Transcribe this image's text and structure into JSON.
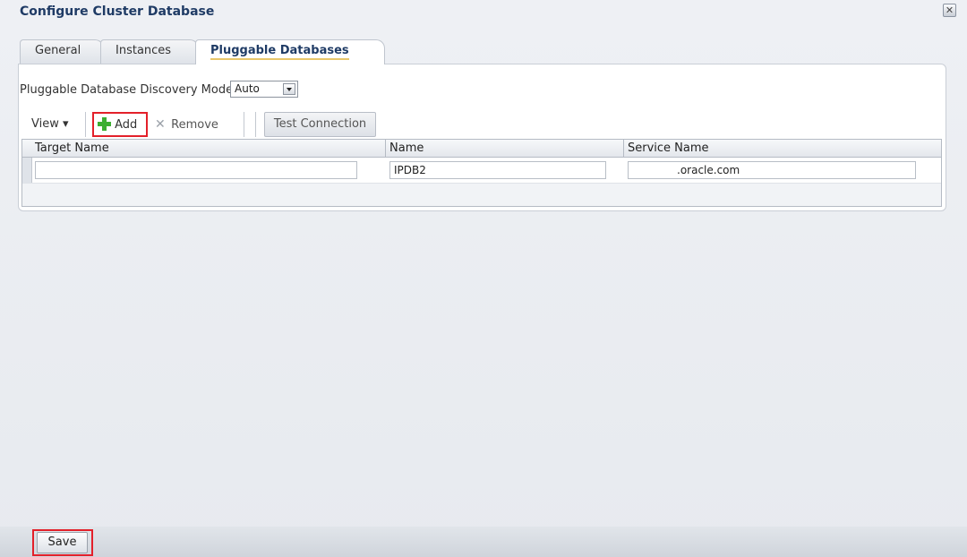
{
  "dialog": {
    "title": "Configure Cluster Database",
    "close_glyph": "✕"
  },
  "tabs": [
    {
      "label": "General"
    },
    {
      "label": "Instances"
    },
    {
      "label": "Pluggable Databases",
      "active": true
    }
  ],
  "discovery": {
    "label": "Pluggable Database Discovery Mode",
    "value": "Auto"
  },
  "toolbar": {
    "view_label": "View ▾",
    "add_label": "Add",
    "remove_label": "Remove",
    "test_connection_label": "Test Connection"
  },
  "table": {
    "columns": [
      "Target Name",
      "Name",
      "Service Name"
    ],
    "rows": [
      {
        "target_name": "",
        "name": "IPDB2",
        "service_name": ".oracle.com"
      }
    ]
  },
  "footer": {
    "save_label": "Save"
  },
  "colors": {
    "accent_red": "#e3202a",
    "plus_green": "#3cae32",
    "title_blue": "#1f3b65"
  }
}
